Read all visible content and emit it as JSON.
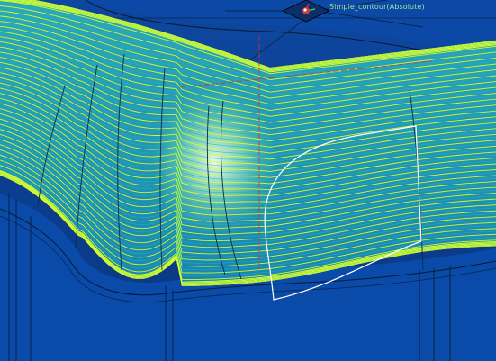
{
  "viewport": {
    "csys_label": "Simple_contour(Absolute)"
  },
  "colors": {
    "background": "#0d3e8e",
    "part_body": "#0a4aa8",
    "part_body_dark": "#073782",
    "toolpath": "#d7ff2a",
    "toolpath_alt": "#18b7c9",
    "surface_highlight": "#e8ffd0",
    "boundary": "#ffffff",
    "edges": "#0a1a33",
    "axis_red": "#d93030",
    "csys_text": "#9ee39e"
  },
  "icons": [
    "csys-triad-icon"
  ]
}
